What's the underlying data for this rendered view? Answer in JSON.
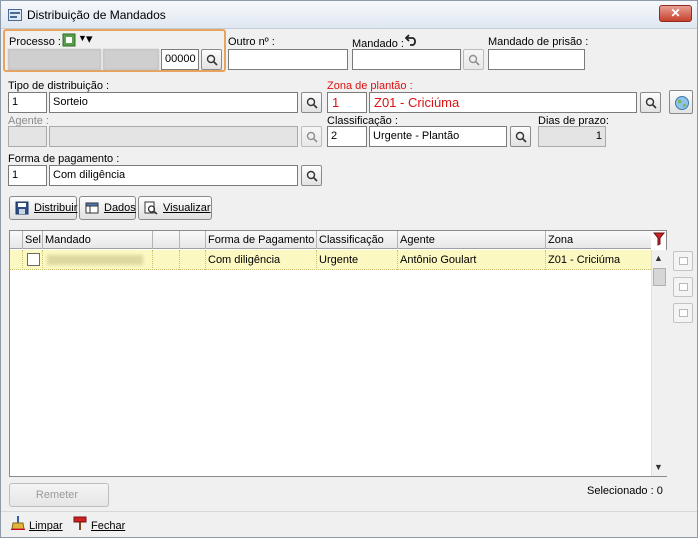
{
  "window": {
    "title": "Distribuição de Mandados",
    "close": "✕"
  },
  "processo": {
    "label": "Processo :",
    "part1": "",
    "part2": "",
    "part3": "00000"
  },
  "outro": {
    "label": "Outro nº :",
    "value": ""
  },
  "mandado": {
    "label": "Mandado :",
    "value": ""
  },
  "mandado_prisao": {
    "label": "Mandado de prisão :",
    "value": ""
  },
  "tipo_distribuicao": {
    "label": "Tipo de distribuição :",
    "code": "1",
    "value": "Sorteio"
  },
  "zona_plantao": {
    "label": "Zona de plantão :",
    "code": "1",
    "value": "Z01 - Criciúma"
  },
  "agente": {
    "label": "Agente :",
    "code": "",
    "value": ""
  },
  "classificacao": {
    "label": "Classificação :",
    "code": "2",
    "value": "Urgente - Plantão"
  },
  "dias_prazo": {
    "label": "Dias de prazo:",
    "value": "1"
  },
  "forma_pagamento": {
    "label": "Forma de pagamento :",
    "code": "1",
    "value": "Com diligência"
  },
  "actions": {
    "distribuir": "Distribuir",
    "dados": "Dados",
    "visualizar": "Visualizar"
  },
  "grid": {
    "columns": [
      "Sel",
      "Mandado",
      "",
      "",
      "Forma de Pagamento",
      "Classificação",
      "Agente",
      "Zona"
    ],
    "rows": [
      {
        "sel": false,
        "mandado": "",
        "forma": "Com diligência",
        "classificacao": "Urgente",
        "agente": "Antônio Goulart",
        "zona": "Z01 - Criciúma"
      }
    ]
  },
  "remeter": "Remeter",
  "selecionado": "Selecionado : 0",
  "footer": {
    "limpar": "Limpar",
    "fechar": "Fechar"
  },
  "colors": {
    "accent": "#e8a35c",
    "required": "#dd1111",
    "row_highlight": "#fbf8c2"
  }
}
